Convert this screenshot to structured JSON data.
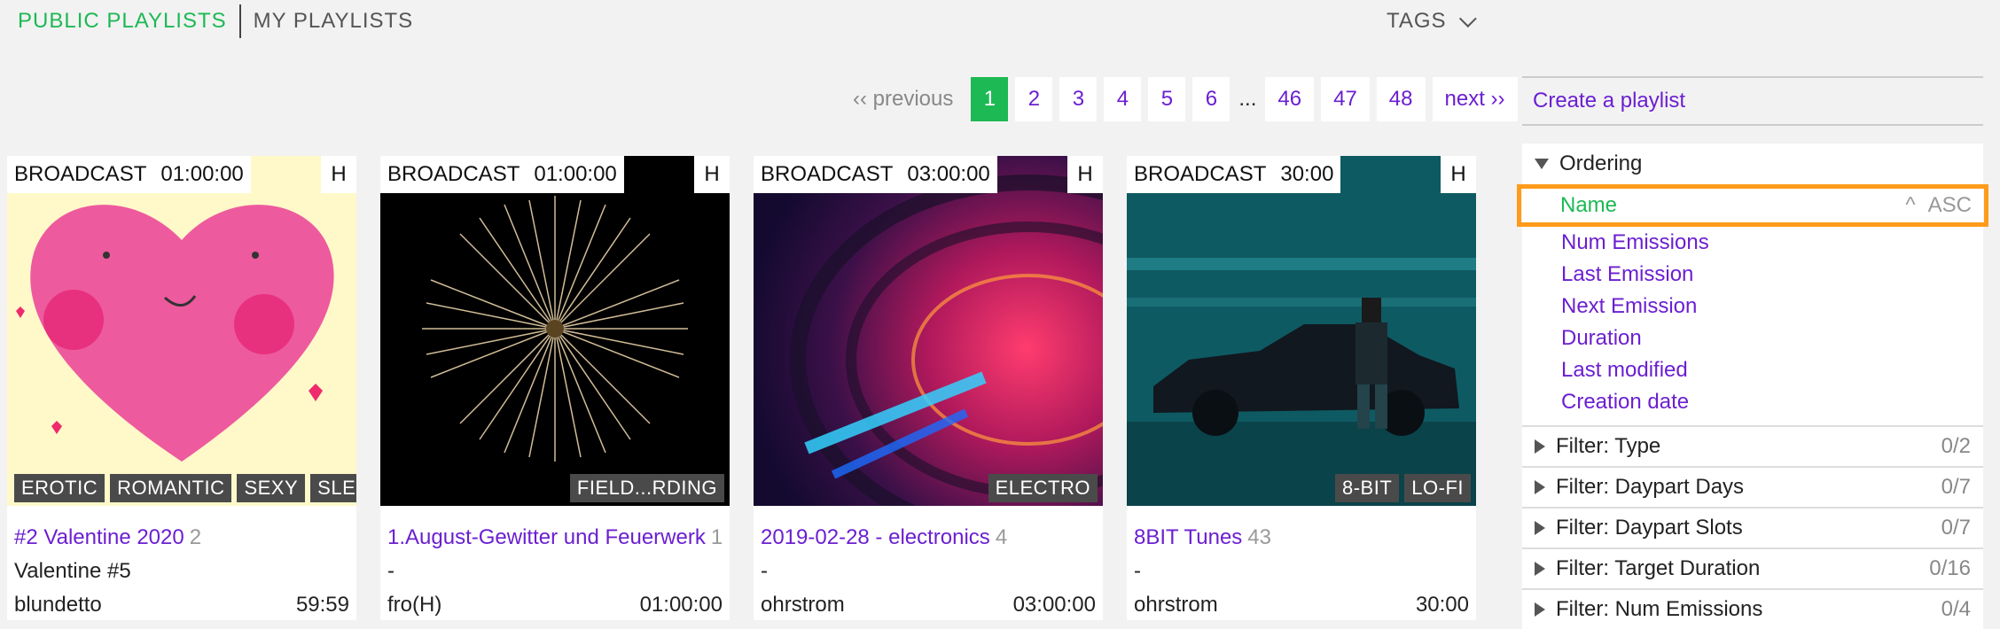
{
  "nav": {
    "public_label": "PUBLIC PLAYLISTS",
    "mine_label": "MY PLAYLISTS",
    "tags_label": "TAGS"
  },
  "pagination": {
    "previous": "‹‹ previous",
    "pages": [
      "1",
      "2",
      "3",
      "4",
      "5",
      "6"
    ],
    "ellipsis": "...",
    "tail": [
      "46",
      "47",
      "48"
    ],
    "current": "1",
    "next": "next ››"
  },
  "cards": [
    {
      "type": "BROADCAST",
      "duration": "01:00:00",
      "h": "H",
      "tags": [
        "EROTIC",
        "ROMANTIC",
        "SEXY",
        "SLEEP"
      ],
      "title": "#2 Valentine 2020",
      "count": "2",
      "description": "Valentine #5",
      "owner": "blundetto",
      "length": "59:59",
      "image": "pink-heart-painting"
    },
    {
      "type": "BROADCAST",
      "duration": "01:00:00",
      "h": "H",
      "tags": [
        "FIELD...RDING"
      ],
      "title": "1.August-Gewitter und Feuerwerk",
      "count": "1",
      "description": "-",
      "owner": "fro(H)",
      "length": "01:00:00",
      "image": "firework-burst"
    },
    {
      "type": "BROADCAST",
      "duration": "03:00:00",
      "h": "H",
      "tags": [
        "ELECTRO"
      ],
      "title": "2019-02-28 - electronics",
      "count": "4",
      "description": "-",
      "owner": "ohrstrom",
      "length": "03:00:00",
      "image": "vinyl-turntable-neon"
    },
    {
      "type": "BROADCAST",
      "duration": "30:00",
      "h": "H",
      "tags": [
        "8-BIT",
        "LO-FI"
      ],
      "title": "8BIT Tunes",
      "count": "43",
      "description": "-",
      "owner": "ohrstrom",
      "length": "30:00",
      "image": "pixel-car-man"
    }
  ],
  "sidebar": {
    "create": "Create a playlist",
    "ordering": {
      "header": "Ordering",
      "selected": {
        "label": "Name",
        "caret": "^",
        "dir": "ASC"
      },
      "items": [
        "Num Emissions",
        "Last Emission",
        "Next Emission",
        "Duration",
        "Last modified",
        "Creation date"
      ]
    },
    "filters": [
      {
        "label": "Filter: Type",
        "count": "0/2"
      },
      {
        "label": "Filter: Daypart Days",
        "count": "0/7"
      },
      {
        "label": "Filter: Daypart Slots",
        "count": "0/7"
      },
      {
        "label": "Filter: Target Duration",
        "count": "0/16"
      },
      {
        "label": "Filter: Num Emissions",
        "count": "0/4"
      }
    ]
  },
  "colors": {
    "accent_green": "#1db954",
    "link_purple": "#6b1fd1",
    "highlight_orange": "#ff9b1a"
  }
}
